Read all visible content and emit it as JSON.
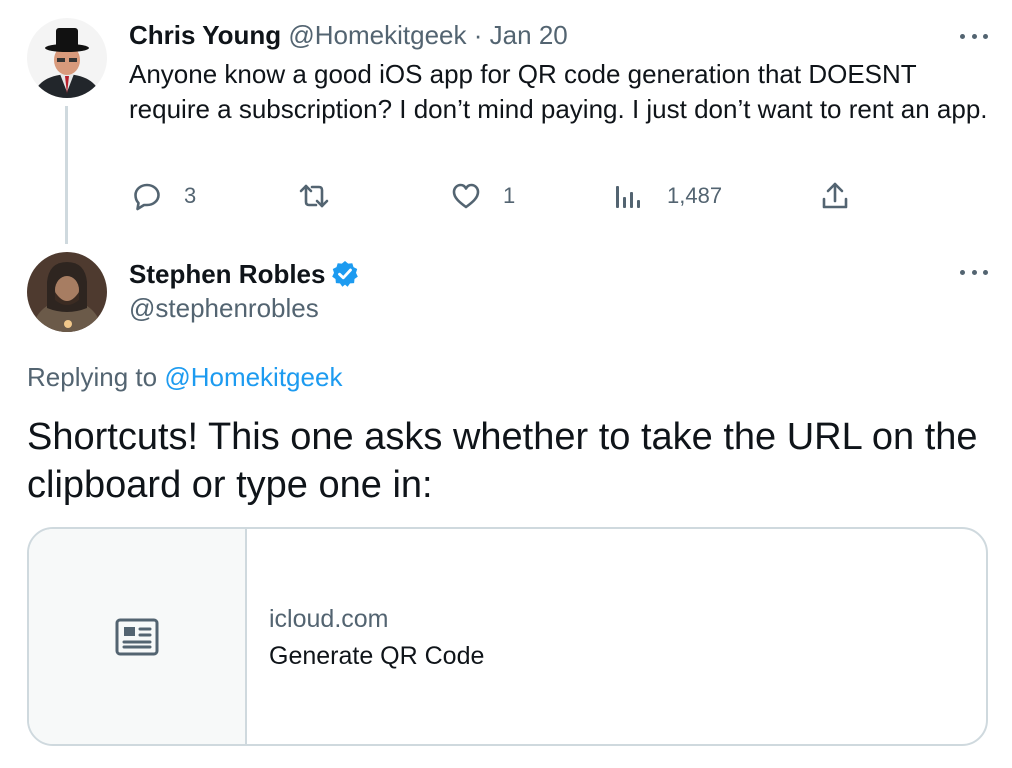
{
  "tweet1": {
    "author_name": "Chris Young",
    "handle": "@Homekitgeek",
    "separator": "·",
    "date": "Jan 20",
    "text": "Anyone know a good iOS app for QR code generation that DOESNT require a subscription? I don’t mind paying. I just don’t want to rent an app.",
    "actions": {
      "reply_count": "3",
      "retweet_count": "",
      "like_count": "1",
      "views_count": "1,487"
    }
  },
  "tweet2": {
    "author_name": "Stephen Robles",
    "handle": "@stephenrobles",
    "replying_prefix": "Replying to",
    "replying_handle": "@Homekitgeek",
    "text": "Shortcuts! This one asks whether to take the URL on the clipboard or type one in:",
    "card": {
      "domain": "icloud.com",
      "title": "Generate QR Code",
      "icon": "article-icon"
    }
  },
  "icons": {
    "more": "more-horizontal-icon",
    "reply": "reply-icon",
    "retweet": "retweet-icon",
    "like": "heart-icon",
    "views": "views-chart-icon",
    "share": "share-icon",
    "verified": "verified-badge-icon"
  },
  "colors": {
    "text_primary": "#0f1419",
    "text_secondary": "#536471",
    "accent": "#1d9bf0",
    "border": "#cfd9de",
    "card_media_bg": "#f7f9f9"
  }
}
